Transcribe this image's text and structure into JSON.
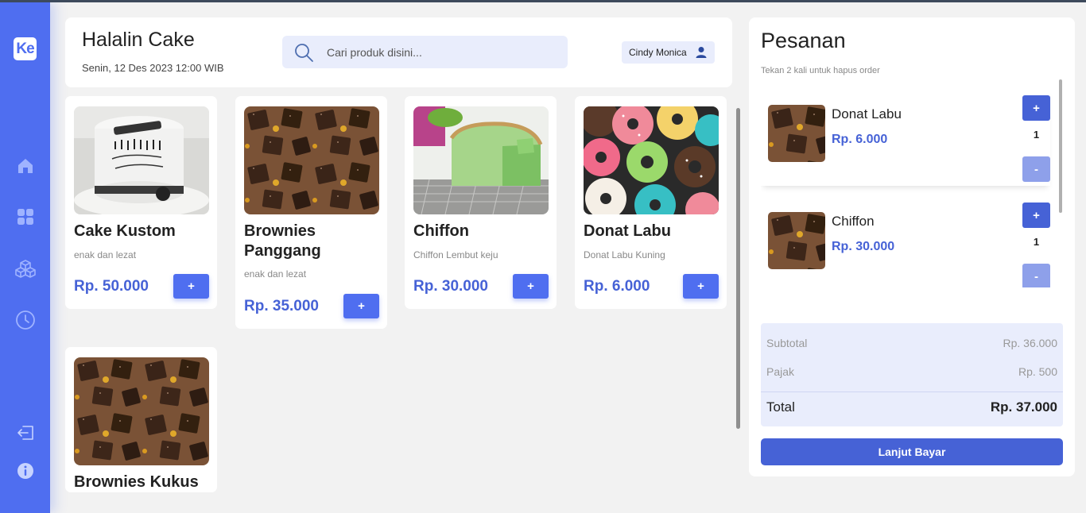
{
  "sidebar": {
    "logo": "Ke",
    "icons": [
      "home-icon",
      "grid-icon",
      "boxes-icon",
      "history-icon",
      "logout-icon",
      "info-icon"
    ]
  },
  "header": {
    "shop_name": "Halalin Cake",
    "date": "Senin, 12 Des 2023 12:00 WIB",
    "search_placeholder": "Cari produk disini...",
    "user_name": "Cindy Monica"
  },
  "products": [
    {
      "name": "Cake Kustom",
      "desc": "enak dan lezat",
      "price": "Rp. 50.000",
      "add_label": "+"
    },
    {
      "name": "Brownies Panggang",
      "desc": "enak dan lezat",
      "price": "Rp. 35.000",
      "add_label": "+"
    },
    {
      "name": "Chiffon",
      "desc": "Chiffon Lembut keju",
      "price": "Rp. 30.000",
      "add_label": "+"
    },
    {
      "name": "Donat Labu",
      "desc": "Donat Labu Kuning",
      "price": "Rp. 6.000",
      "add_label": "+"
    },
    {
      "name": "Brownies Kukus",
      "desc": "",
      "price": "",
      "add_label": "+"
    }
  ],
  "orders": {
    "title": "Pesanan",
    "hint": "Tekan 2 kali untuk hapus order",
    "items": [
      {
        "name": "Donat Labu",
        "price": "Rp. 6.000",
        "qty": "1",
        "plus": "+",
        "minus": "-"
      },
      {
        "name": "Chiffon",
        "price": "Rp. 30.000",
        "qty": "1",
        "plus": "+",
        "minus": "-"
      }
    ],
    "subtotal_label": "Subtotal",
    "subtotal_value": "Rp. 36.000",
    "tax_label": "Pajak",
    "tax_value": "Rp. 500",
    "total_label": "Total",
    "total_value": "Rp. 37.000",
    "pay_label": "Lanjut Bayar"
  },
  "colors": {
    "accent": "#4f6ef0",
    "accent_dark": "#4662d6",
    "accent_light": "#e9edfc",
    "background": "#f2f2f2"
  }
}
